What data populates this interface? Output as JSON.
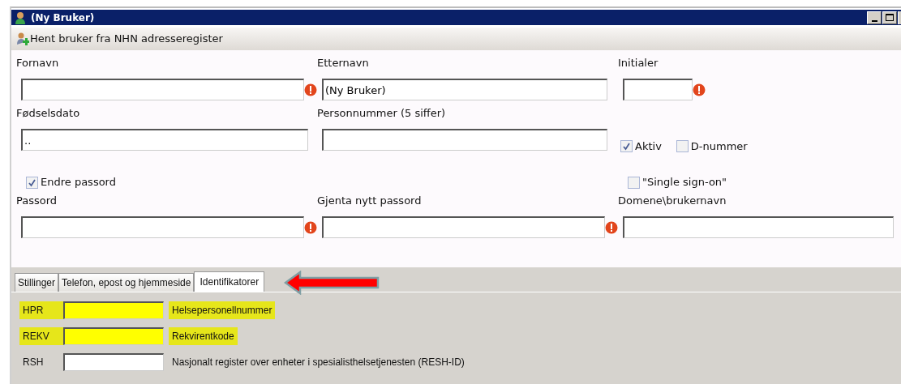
{
  "window": {
    "title": "(Ny Bruker)"
  },
  "toolbar": {
    "label": "Hent bruker fra NHN adresseregister"
  },
  "rows": [
    {
      "kind": "fields",
      "items": [
        {
          "kind": "field",
          "label": "Fornavn",
          "error": true
        },
        {
          "kind": "field",
          "label": "Etternavn",
          "value": "(Ny Bruker)",
          "error": false
        },
        {
          "kind": "short_field",
          "label": "Initialer",
          "error": true
        }
      ]
    },
    {
      "kind": "fields",
      "items": [
        {
          "kind": "field",
          "label": "Fødselsdato",
          "value": "..",
          "error": false
        },
        {
          "kind": "field",
          "label": "Personnummer (5 siffer)",
          "error": false
        },
        {
          "kind": "checks",
          "checks": [
            {
              "label": "Aktiv",
              "checked": true
            },
            {
              "label": "D-nummer",
              "checked": false
            }
          ]
        }
      ]
    },
    {
      "kind": "checks",
      "left": {
        "label": "Endre passord",
        "checked": true
      },
      "right": {
        "label": "\"Single sign-on\"",
        "checked": false
      }
    },
    {
      "kind": "fields",
      "items": [
        {
          "kind": "field",
          "label": "Passord",
          "error": true
        },
        {
          "kind": "field",
          "label": "Gjenta nytt passord",
          "error": true
        },
        {
          "kind": "field",
          "label": "Domene\\brukernavn",
          "error": false
        }
      ]
    }
  ],
  "tabs": [
    {
      "label": "Stillinger",
      "selected": false
    },
    {
      "label": "Telefon, epost og hjemmeside",
      "selected": false
    },
    {
      "label": "Identifikatorer",
      "selected": true
    }
  ],
  "identifiers": [
    {
      "code": "HPR",
      "description": "Helsepersonellnummer",
      "highlighted": true
    },
    {
      "code": "REKV",
      "description": "Rekvirentkode",
      "highlighted": true
    },
    {
      "code": "RSH",
      "description": "Nasjonalt register over enheter i spesialisthelsetjenesten (RESH-ID)",
      "highlighted": false
    }
  ]
}
